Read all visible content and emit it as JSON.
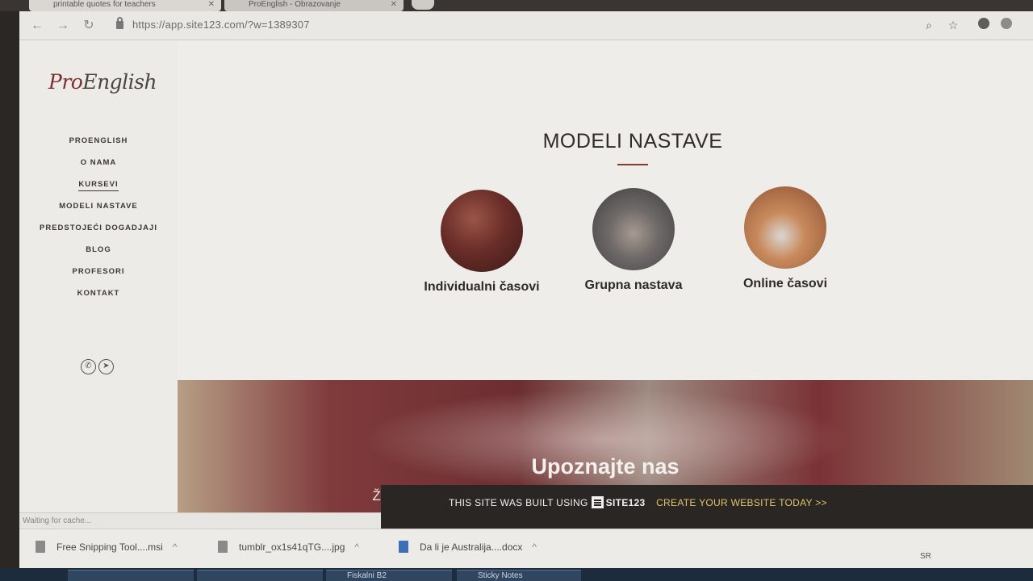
{
  "browser": {
    "tabs": [
      {
        "label": "printable quotes for teachers"
      },
      {
        "label": "ProEnglish - Obrazovanje"
      }
    ],
    "url": "https://app.site123.com/?w=1389307"
  },
  "sidebar": {
    "logo_part1": "Pro",
    "logo_part2": "English",
    "nav": [
      {
        "label": "PROENGLISH"
      },
      {
        "label": "O NAMA"
      },
      {
        "label": "KURSEVI"
      },
      {
        "label": "MODELI NASTAVE"
      },
      {
        "label": "PREDSTOJEĆI DOGADJAJI"
      },
      {
        "label": "BLOG"
      },
      {
        "label": "PROFESORI"
      },
      {
        "label": "KONTAKT"
      }
    ]
  },
  "main": {
    "section_title": "MODELI NASTAVE",
    "cards": [
      {
        "label": "Individualni časovi"
      },
      {
        "label": "Grupna nastava"
      },
      {
        "label": "Online časovi"
      }
    ],
    "hero": {
      "title": "Upoznajte nas",
      "text": "Želite da saznate ko smo i kako radimo da biste odlučili da li da nam ukažete"
    }
  },
  "builtbar": {
    "text": "THIS SITE WAS BUILT USING",
    "brand": "SITE123",
    "cta": "CREATE YOUR WEBSITE TODAY >>"
  },
  "status": {
    "text": "Waiting for cache..."
  },
  "downloads": [
    {
      "name": "Free Snipping Tool....msi",
      "icon": "installer-file-icon"
    },
    {
      "name": "tumblr_ox1s41qTG....jpg",
      "icon": "image-file-icon"
    },
    {
      "name": "Da li je Australija....docx",
      "icon": "word-file-icon"
    }
  ],
  "taskbar": {
    "items": [
      {
        "label": ""
      },
      {
        "label": ""
      },
      {
        "label": "Fiskalni B2"
      },
      {
        "label": "Sticky Notes"
      }
    ],
    "tray_lang": "SR"
  },
  "colors": {
    "accent": "#8a3b2a",
    "cta": "#e0c36a",
    "logo": "#7e2f2f"
  }
}
